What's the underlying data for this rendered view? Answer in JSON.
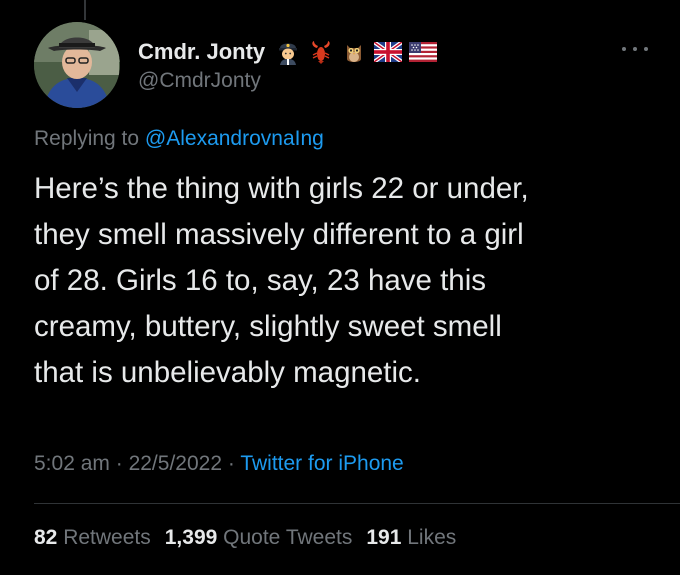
{
  "tweet": {
    "display_name": "Cmdr. Jonty",
    "handle": "@CmdrJonty",
    "name_emojis": [
      "pilot-emoji",
      "lobster-emoji",
      "owl-emoji",
      "uk-flag-emoji",
      "us-flag-emoji"
    ],
    "replying_prefix": "Replying to",
    "replying_to": "@AlexandrovnaIng",
    "text": "Here’s the thing with girls 22 or under,\nthey smell massively different to a girl\nof 28. Girls 16 to, say, 23 have this\ncreamy, buttery,  slightly sweet smell\nthat is unbelievably magnetic.",
    "time": "5:02 am",
    "date": "22/5/2022",
    "separator": "·",
    "source": "Twitter for iPhone"
  },
  "stats": {
    "retweets_count": "82",
    "retweets_label": "Retweets",
    "quotes_count": "1,399",
    "quotes_label": "Quote Tweets",
    "likes_count": "191",
    "likes_label": "Likes"
  },
  "colors": {
    "background": "#000000",
    "text": "#e7e9ea",
    "secondary": "#71767b",
    "link": "#1d9bf0",
    "divider": "#2f3336"
  }
}
